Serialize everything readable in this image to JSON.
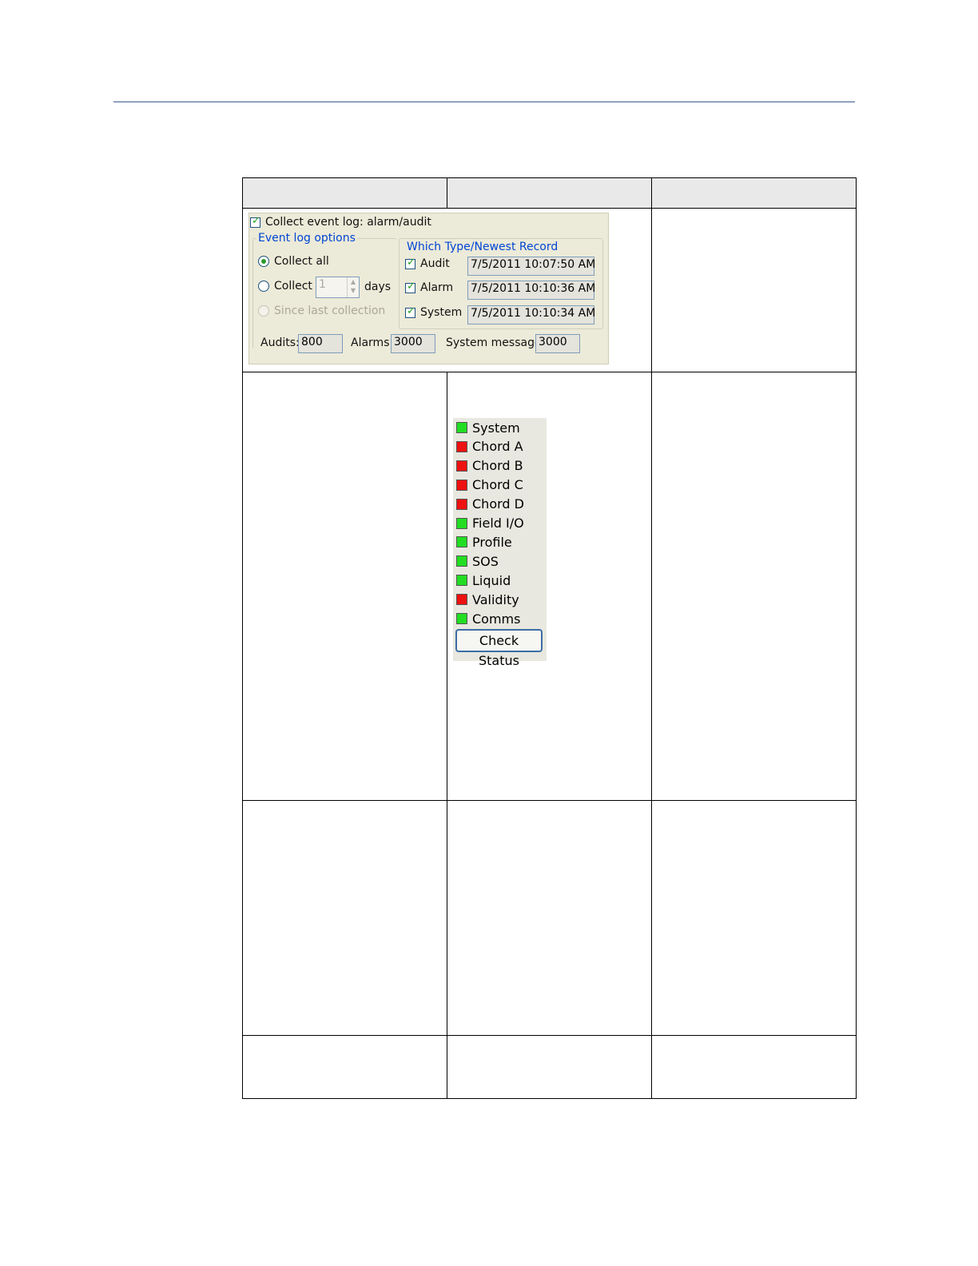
{
  "colors": {
    "rule": "#3a5a8c",
    "header_bg": "#e9e9e9",
    "panel_bg": "#ecead8",
    "group_label": "#0046d5",
    "ok": "#22dd22",
    "fault": "#ee1111"
  },
  "event_log": {
    "collect_label": "Collect event log: alarm/audit",
    "collect_checked": true,
    "options_title": "Event log options",
    "collect_all_label": "Collect all",
    "collect_label2": "Collect",
    "days_value": "1",
    "days_label": "days",
    "since_label": "Since last collection",
    "type_group_title": "Which Type/Newest Record",
    "types": [
      {
        "label": "Audit",
        "date": "7/5/2011 10:07:50 AM",
        "checked": true
      },
      {
        "label": "Alarm",
        "date": "7/5/2011 10:10:36 AM",
        "checked": true
      },
      {
        "label": "System",
        "date": "7/5/2011 10:10:34 AM",
        "checked": true
      }
    ],
    "audits_label": "Audits:",
    "audits_value": "800",
    "alarms_label": "Alarms:",
    "alarms_value": "3000",
    "system_label": "System messages:",
    "system_value": "3000"
  },
  "status": {
    "items": [
      {
        "label": "System",
        "state": "ok"
      },
      {
        "label": "Chord A",
        "state": "fault"
      },
      {
        "label": "Chord B",
        "state": "fault"
      },
      {
        "label": "Chord C",
        "state": "fault"
      },
      {
        "label": "Chord D",
        "state": "fault"
      },
      {
        "label": "Field I/O",
        "state": "ok"
      },
      {
        "label": "Profile",
        "state": "ok"
      },
      {
        "label": "SOS",
        "state": "ok"
      },
      {
        "label": "Liquid",
        "state": "ok"
      },
      {
        "label": "Validity",
        "state": "fault"
      },
      {
        "label": "Comms",
        "state": "ok"
      }
    ],
    "button_label": "Check Status"
  }
}
